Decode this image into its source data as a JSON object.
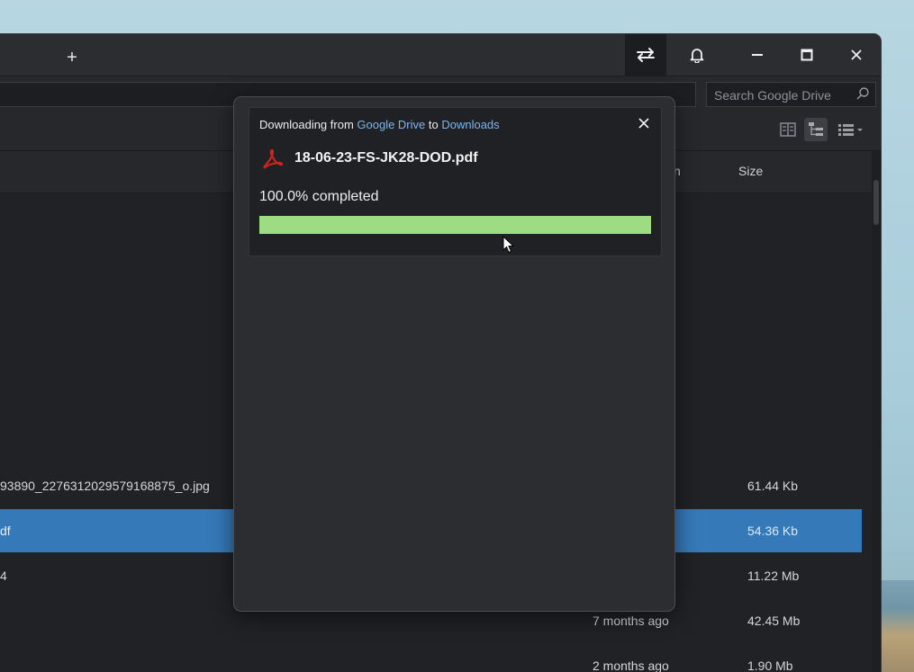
{
  "titlebar": {
    "new_tab_label": "+",
    "icons": [
      "plus-icon",
      "sync-arrows-icon",
      "bell-icon",
      "minimize-icon",
      "maximize-icon",
      "close-icon"
    ]
  },
  "search": {
    "placeholder": "Search Google Drive"
  },
  "columns": {
    "size": "Size",
    "modified_partial": "n"
  },
  "files": [
    {
      "name": "93890_2276312029579168875_o.jpg",
      "modified": "",
      "size": "61.44 Kb",
      "selected": false
    },
    {
      "name": "df",
      "modified": "",
      "size": "54.36 Kb",
      "selected": true
    },
    {
      "name": "4",
      "modified": "",
      "size": "11.22 Mb",
      "selected": false
    },
    {
      "name": "",
      "modified": "7 months ago",
      "size": "42.45 Mb",
      "selected": false
    },
    {
      "name": "",
      "modified": "2 months ago",
      "size": "1.90 Mb",
      "selected": false
    }
  ],
  "download": {
    "prefix": "Downloading from ",
    "source": "Google Drive",
    "middle": " to ",
    "destination": "Downloads",
    "file_name": "18-06-23-FS-JK28-DOD.pdf",
    "progress_text": "100.0% completed",
    "progress_fraction": 1.0,
    "file_icon": "pdf-icon"
  },
  "colors": {
    "selection": "#3579b8",
    "progress": "#9edc84",
    "link": "#7fb6ee",
    "pdf_red": "#c8261e"
  }
}
